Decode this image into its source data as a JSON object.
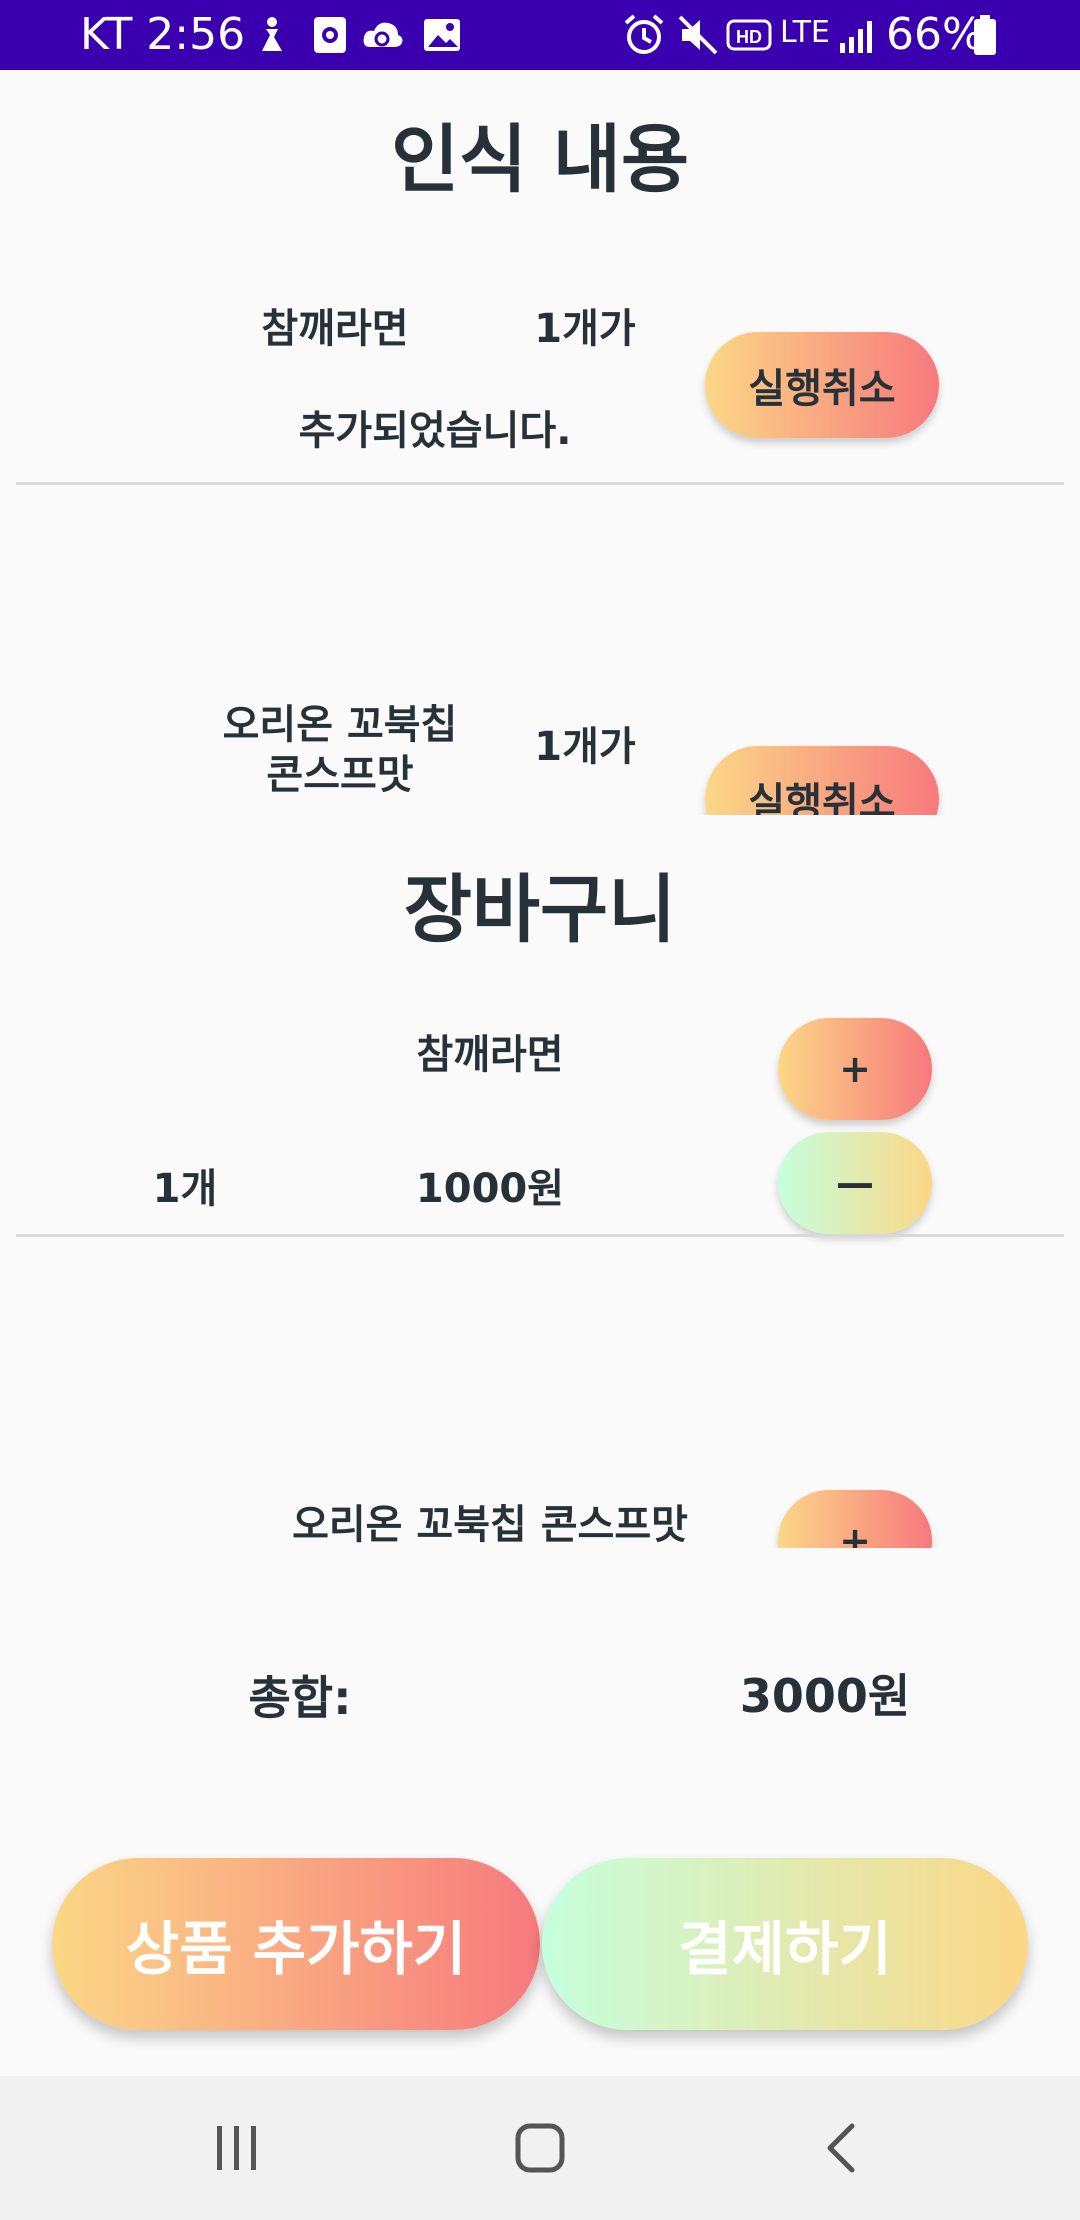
{
  "status_bar": {
    "carrier_time": "KT 2:56",
    "network": "LTE",
    "battery": "66%",
    "color": "#3a00b0"
  },
  "recognition": {
    "title": "인식 내용",
    "items": [
      {
        "name": "참깨라면",
        "qty": "1개가",
        "message": "추가되었습니다.",
        "undo_label": "실행취소"
      },
      {
        "name": "오리온 꼬북칩 콘스프맛",
        "qty": "1개가",
        "undo_label": "실행취소"
      }
    ]
  },
  "cart": {
    "title": "장바구니",
    "items": [
      {
        "name": "참깨라면",
        "qty": "1개",
        "price": "1000원",
        "plus_label": "+",
        "minus_label": "—"
      },
      {
        "name": "오리온 꼬북칩 콘스프맛",
        "plus_label": "+"
      }
    ]
  },
  "total": {
    "label": "총합:",
    "value": "3000원"
  },
  "actions": {
    "add_label": "상품 추가하기",
    "pay_label": "결제하기"
  },
  "nav": {
    "recent_icon": "recent-apps-icon",
    "home_icon": "home-icon",
    "back_icon": "back-icon"
  },
  "colors": {
    "warm_gradient": [
      "#fbd786",
      "#f7797d"
    ],
    "mint_gradient": [
      "#c6ffdd",
      "#fbd786"
    ],
    "text": "#263238"
  }
}
